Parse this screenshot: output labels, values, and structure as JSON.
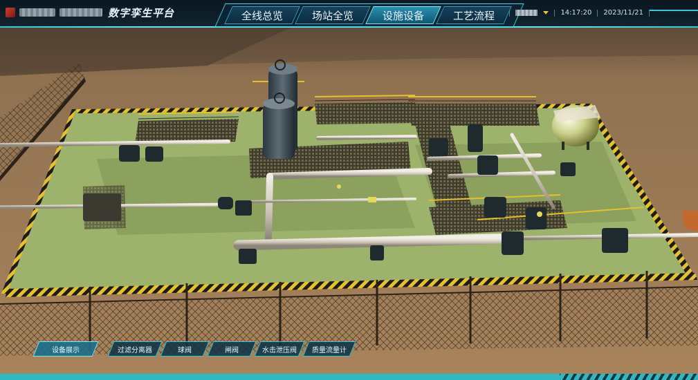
{
  "brand": {
    "title": "数字孪生平台"
  },
  "nav": {
    "tabs": [
      {
        "label": "全线总览"
      },
      {
        "label": "场站全览"
      },
      {
        "label": "设施设备",
        "active": true
      },
      {
        "label": "工艺流程"
      }
    ]
  },
  "status": {
    "time": "14:17:20",
    "date": "2023/11/21"
  },
  "bottom": {
    "primary": "设备展示",
    "items": [
      {
        "label": "过滤分离器"
      },
      {
        "label": "球阀"
      },
      {
        "label": "闸阀"
      },
      {
        "label": "水击泄压阀"
      },
      {
        "label": "质量流量计"
      }
    ]
  },
  "colors": {
    "accent": "#35c9d8",
    "ground": "#9b7a55",
    "pad": "#9db26a",
    "hazard": "#e5c22b",
    "header_bg": "#081e2c"
  },
  "icons": {
    "logo": "brand-logo-icon",
    "dropdown": "caret-down-icon"
  }
}
